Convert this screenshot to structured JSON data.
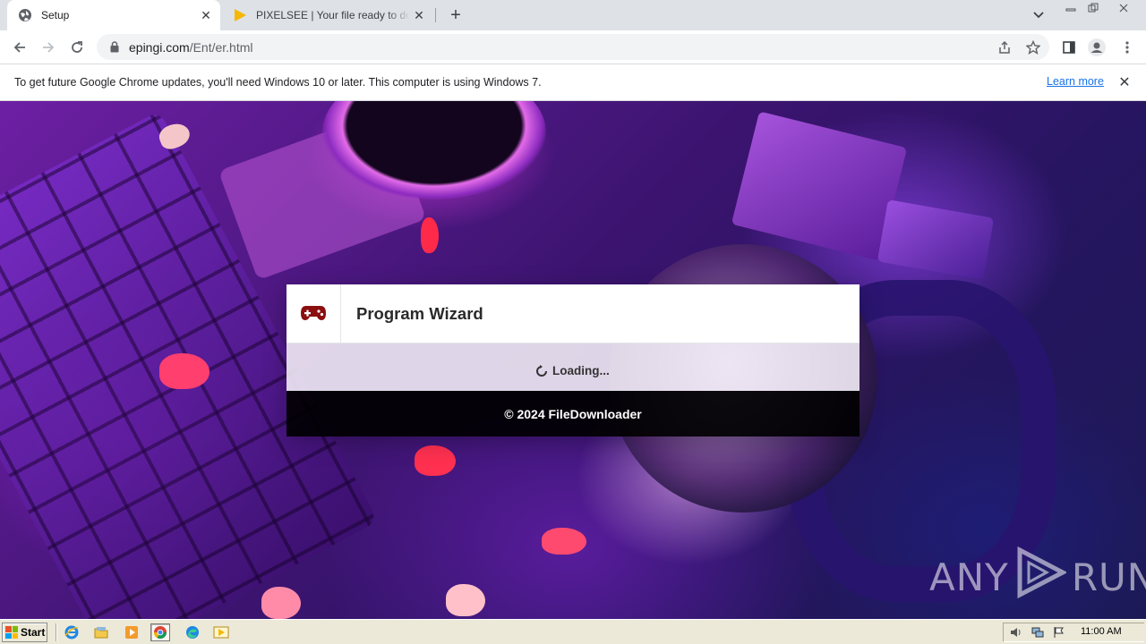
{
  "browser": {
    "tabs": [
      {
        "title": "Setup",
        "active": true,
        "favicon": "globe-icon"
      },
      {
        "title": "PIXELSEE | Your file ready to download",
        "active": false,
        "favicon": "play-triangle-icon"
      }
    ],
    "address_bar": {
      "host": "epingi.com",
      "path": "/Ent/er.html"
    }
  },
  "infobar": {
    "message": "To get future Google Chrome updates, you'll need Windows 10 or later. This computer is using Windows 7.",
    "link_label": "Learn more"
  },
  "wizard": {
    "title": "Program Wizard",
    "loading_text": "Loading...",
    "footer": "© 2024 FileDownloader"
  },
  "watermark": {
    "left": "ANY",
    "right": "RUN"
  },
  "taskbar": {
    "start_label": "Start",
    "clock": "11:00 AM"
  },
  "colors": {
    "accent_link": "#1a73e8",
    "gamepad_icon": "#8b0f0f",
    "footer_bg": "#000000"
  }
}
